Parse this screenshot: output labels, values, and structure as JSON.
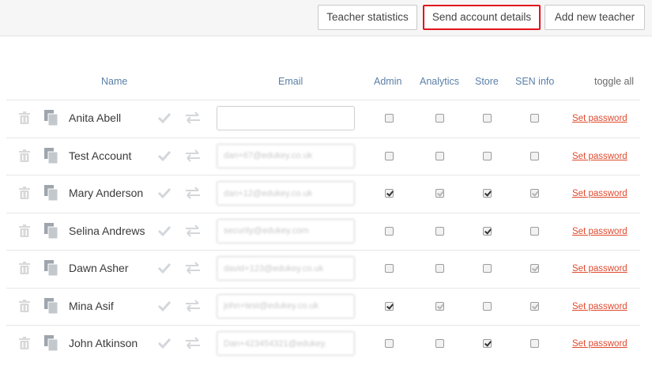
{
  "toolbar": {
    "teacher_statistics": "Teacher statistics",
    "send_account_details": "Send account details",
    "add_new_teacher": "Add new teacher"
  },
  "columns": {
    "name": "Name",
    "email": "Email",
    "admin": "Admin",
    "analytics": "Analytics",
    "store": "Store",
    "sen_info": "SEN info",
    "toggle_all": "toggle all"
  },
  "colors": {
    "highlight_border": "#e3141b",
    "link": "#e04a2e",
    "header_text": "#5a7fa8"
  },
  "teachers": [
    {
      "name": "Anita Abell",
      "email": "",
      "admin": false,
      "analytics": false,
      "store": false,
      "sen": false,
      "set_password": "Set password"
    },
    {
      "name": "Test Account",
      "email": "dan+67@edukey.co.uk",
      "admin": false,
      "analytics": false,
      "store": false,
      "sen": false,
      "set_password": "Set password"
    },
    {
      "name": "Mary Anderson",
      "email": "dan+12@edukey.co.uk",
      "admin": true,
      "analytics": true,
      "store": true,
      "sen": true,
      "set_password": "Set password"
    },
    {
      "name": "Selina Andrews",
      "email": "security@edukey.com",
      "admin": false,
      "analytics": false,
      "store": true,
      "sen": false,
      "set_password": "Set password"
    },
    {
      "name": "Dawn Asher",
      "email": "david+123@edukey.co.uk",
      "admin": false,
      "analytics": false,
      "store": false,
      "sen": true,
      "set_password": "Set password"
    },
    {
      "name": "Mina Asif",
      "email": "john+test@edukey.co.uk",
      "admin": true,
      "analytics": true,
      "store": false,
      "sen": true,
      "set_password": "Set password"
    },
    {
      "name": "John Atkinson",
      "email": "Dan+423454321@edukey.",
      "admin": false,
      "analytics": false,
      "store": true,
      "sen": false,
      "set_password": "Set password"
    }
  ]
}
